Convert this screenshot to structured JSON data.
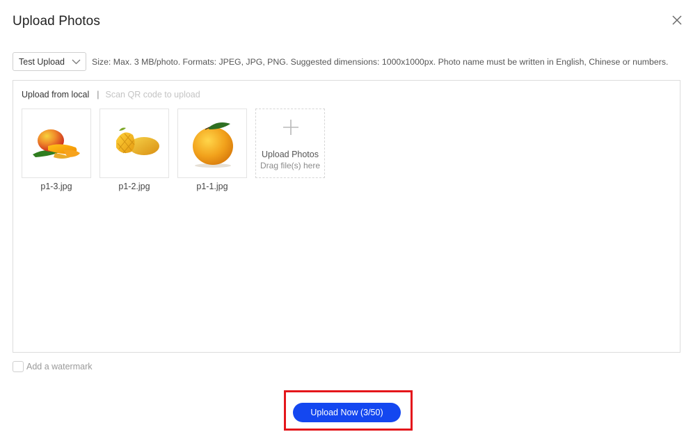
{
  "dialog": {
    "title": "Upload Photos",
    "close_icon": "close-icon"
  },
  "toolbar": {
    "album_select": {
      "selected": "Test Upload",
      "icon": "chevron-down-icon"
    },
    "hint": "Size: Max. 3 MB/photo. Formats: JPEG, JPG, PNG. Suggested dimensions: 1000x1000px. Photo name must be written in English, Chinese or numbers."
  },
  "panel": {
    "tabs": {
      "local": "Upload from local",
      "separator": "|",
      "qr": "Scan QR code to upload"
    },
    "photos": [
      {
        "name": "p1-3.jpg",
        "image": "mango-slices-image"
      },
      {
        "name": "p1-2.jpg",
        "image": "mango-cubed-image"
      },
      {
        "name": "p1-1.jpg",
        "image": "whole-mango-image"
      }
    ],
    "add_tile": {
      "icon": "plus-icon",
      "title": "Upload Photos",
      "subtitle": "Drag file(s) here"
    }
  },
  "watermark": {
    "label": "Add a watermark",
    "checked": false
  },
  "footer": {
    "upload_button": "Upload Now (3/50)"
  },
  "colors": {
    "primary_button": "#1447f0",
    "highlight_border": "#e4161b",
    "panel_border": "#dcdcdc",
    "disabled_text": "#c4c4c4"
  }
}
